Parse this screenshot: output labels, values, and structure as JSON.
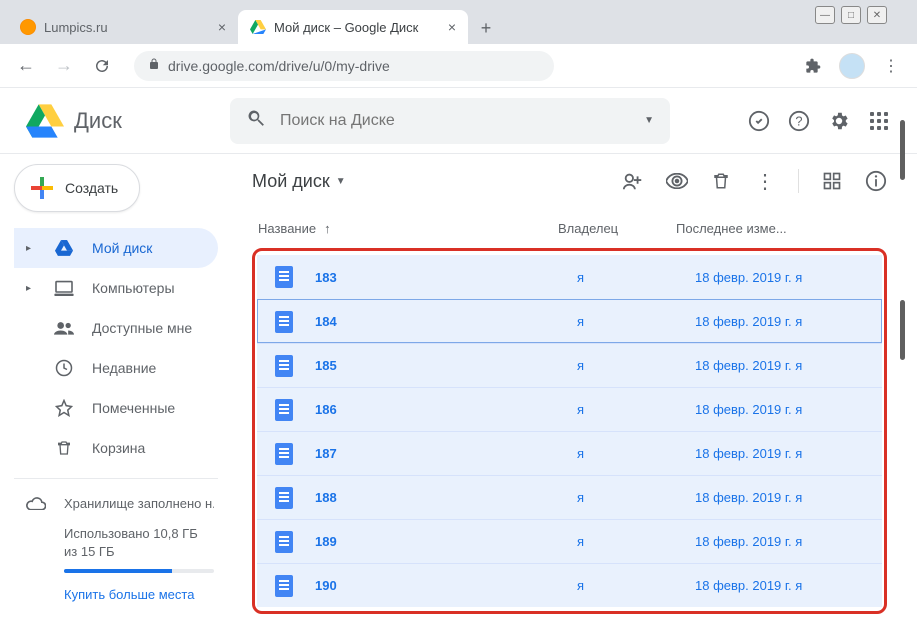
{
  "window": {
    "title": "Мой диск – Google Диск"
  },
  "tabs": [
    {
      "title": "Lumpics.ru",
      "favicon": "orange",
      "active": false
    },
    {
      "title": "Мой диск – Google Диск",
      "favicon": "drive",
      "active": true
    }
  ],
  "address_bar": {
    "url": "drive.google.com/drive/u/0/my-drive"
  },
  "app": {
    "product_name": "Диск",
    "search_placeholder": "Поиск на Диске"
  },
  "create_button_label": "Создать",
  "sidebar": {
    "items": [
      {
        "label": "Мой диск",
        "icon": "mydrive",
        "active": true,
        "expandable": true
      },
      {
        "label": "Компьютеры",
        "icon": "computers"
      },
      {
        "label": "Доступные мне",
        "icon": "shared"
      },
      {
        "label": "Недавние",
        "icon": "recent"
      },
      {
        "label": "Помеченные",
        "icon": "starred"
      },
      {
        "label": "Корзина",
        "icon": "trash"
      }
    ],
    "storage": {
      "title": "Хранилище заполнено н...",
      "usage_text": "Использовано 10,8 ГБ из 15 ГБ",
      "percent": 72,
      "buy_more": "Купить больше места"
    }
  },
  "content": {
    "breadcrumb": "Мой диск",
    "toolbar_icons": [
      "share",
      "preview",
      "delete",
      "more",
      "grid",
      "info"
    ],
    "columns": {
      "name": "Название",
      "owner": "Владелец",
      "modified": "Последнее изме..."
    },
    "files": [
      {
        "name": "183",
        "owner": "я",
        "modified": "18 февр. 2019 г. я"
      },
      {
        "name": "184",
        "owner": "я",
        "modified": "18 февр. 2019 г. я"
      },
      {
        "name": "185",
        "owner": "я",
        "modified": "18 февр. 2019 г. я"
      },
      {
        "name": "186",
        "owner": "я",
        "modified": "18 февр. 2019 г. я"
      },
      {
        "name": "187",
        "owner": "я",
        "modified": "18 февр. 2019 г. я"
      },
      {
        "name": "188",
        "owner": "я",
        "modified": "18 февр. 2019 г. я"
      },
      {
        "name": "189",
        "owner": "я",
        "modified": "18 февр. 2019 г. я"
      },
      {
        "name": "190",
        "owner": "я",
        "modified": "18 февр. 2019 г. я"
      }
    ],
    "focus_row_index": 1
  }
}
